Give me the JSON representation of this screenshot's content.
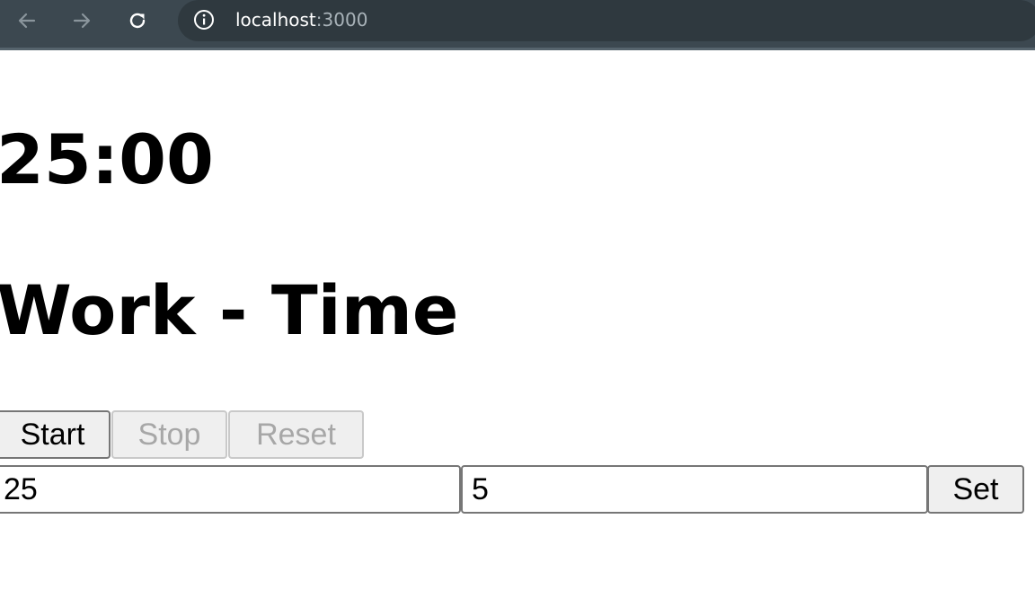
{
  "browser": {
    "url_host": "localhost",
    "url_port": ":3000",
    "icons": [
      "back-arrow-icon",
      "forward-arrow-icon",
      "reload-icon",
      "info-icon"
    ]
  },
  "app": {
    "timer_display": "25:00",
    "mode_label": "Work - Time",
    "buttons": {
      "start_label": "Start",
      "stop_label": "Stop",
      "reset_label": "Reset",
      "set_label": "Set"
    },
    "inputs": {
      "work_minutes": "25",
      "break_minutes": "5"
    }
  }
}
